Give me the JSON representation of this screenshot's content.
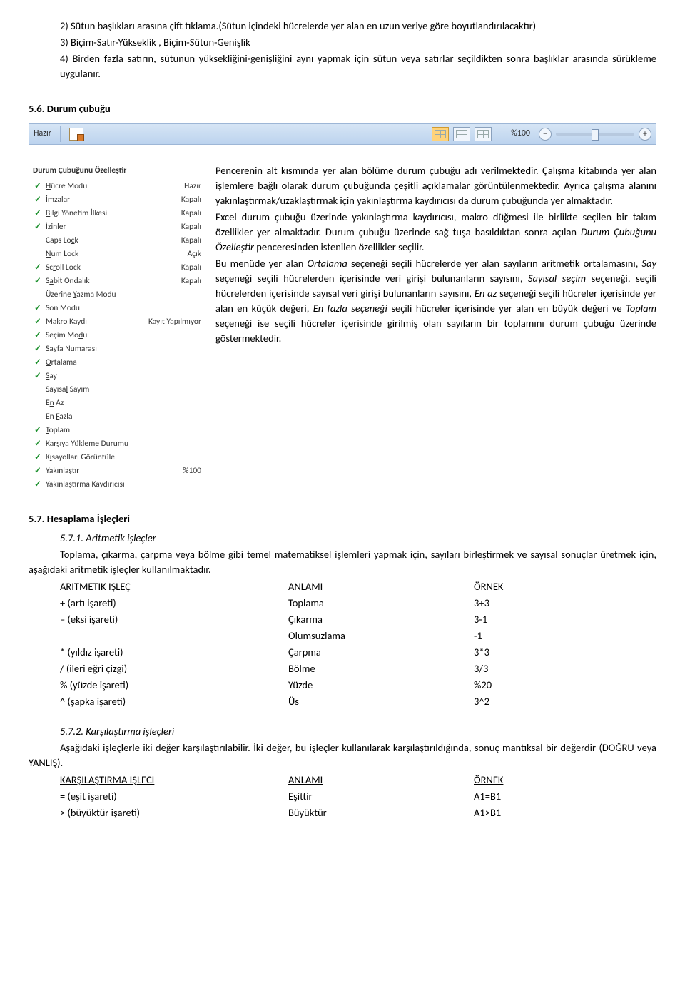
{
  "top": {
    "l1": "2) Sütun başlıkları arasına çift tıklama.(Sütun içindeki hücrelerde yer alan en uzun veriye göre boyutlandırılacaktır)",
    "l2": "3) Biçim-Satır-Yükseklik , Biçim-Sütun-Genişlik",
    "l3": "4) Birden fazla satırın, sütunun yüksekliğini-genişliğini aynı yapmak için sütun veya satırlar seçildikten sonra başlıklar arasında sürükleme uygulanır."
  },
  "s56": {
    "title": "5.6. Durum çubuğu"
  },
  "statusbar": {
    "ready": "Hazır",
    "zoom": "%100"
  },
  "customize": {
    "title": "Durum Çubuğunu Özelleştir",
    "rows": [
      {
        "chk": true,
        "label": "<u>H</u>ücre Modu",
        "value": "Hazır"
      },
      {
        "chk": true,
        "label": "<u>İ</u>mzalar",
        "value": "Kapalı"
      },
      {
        "chk": true,
        "label": "<u>B</u>ilgi Yönetim İlkesi",
        "value": "Kapalı"
      },
      {
        "chk": true,
        "label": "<u>İ</u>zinler",
        "value": "Kapalı"
      },
      {
        "chk": false,
        "label": "Caps Lo<u>c</u>k",
        "value": "Kapalı"
      },
      {
        "chk": false,
        "label": "<u>N</u>um Lock",
        "value": "Açık"
      },
      {
        "chk": true,
        "label": "Sc<u>r</u>oll Lock",
        "value": "Kapalı"
      },
      {
        "chk": true,
        "label": "S<u>a</u>bit Ondalık",
        "value": "Kapalı"
      },
      {
        "chk": false,
        "label": "Üzerine <u>Y</u>azma Modu",
        "value": ""
      },
      {
        "chk": true,
        "label": "Son Modu",
        "value": ""
      },
      {
        "chk": true,
        "label": "<u>M</u>akro Kaydı",
        "value": "Kayıt Yapılmıyor"
      },
      {
        "chk": true,
        "label": "Seçim Mo<u>d</u>u",
        "value": ""
      },
      {
        "chk": true,
        "label": "Say<u>f</u>a Numarası",
        "value": ""
      },
      {
        "chk": true,
        "label": "<u>O</u>rtalama",
        "value": ""
      },
      {
        "chk": true,
        "label": "<u>S</u>ay",
        "value": ""
      },
      {
        "chk": false,
        "label": "Sayısa<u>l</u> Sayım",
        "value": ""
      },
      {
        "chk": false,
        "label": "E<u>n</u> Az",
        "value": ""
      },
      {
        "chk": false,
        "label": "En <u>F</u>azla",
        "value": ""
      },
      {
        "chk": true,
        "label": "<u>T</u>oplam",
        "value": ""
      },
      {
        "chk": true,
        "label": "<u>K</u>arşıya Yükleme Durumu",
        "value": ""
      },
      {
        "chk": true,
        "label": "K<u>ı</u>sayolları Görüntüle",
        "value": ""
      },
      {
        "chk": true,
        "label": "<u>Y</u>akınlaştır",
        "value": "%100"
      },
      {
        "chk": true,
        "label": "Yakınlaştırma Kaydırıcısı",
        "value": ""
      }
    ]
  },
  "right": {
    "p1a": "Pencerenin alt kısmında yer alan bölüme durum çubuğu adı verilmektedir. Çalışma kitabında yer alan işlemlere bağlı olarak durum çubuğunda çeşitli açıklamalar görüntülenmektedir. Ayrıca çalışma alanını yakınlaştırmak/uzaklaştırmak için yakınlaştırma kaydırıcısı da durum çubuğunda yer almaktadır.",
    "p1b": "Excel durum çubuğu üzerinde yakınlaştırma kaydırıcısı, makro düğmesi ile birlikte seçilen bir takım özellikler yer almaktadır. Durum çubuğu üzerinde sağ tuşa basıldıktan sonra açılan ",
    "p1b_i": "Durum Çubuğunu Özelleştir",
    "p1b2": " penceresinden istenilen özellikler seçilir.",
    "p2a": "Bu menüde yer alan ",
    "p2_ort": "Ortalama",
    "p2b": " seçeneği seçili hücrelerde yer alan sayıların aritmetik ortalamasını, ",
    "p2_say": "Say",
    "p2c": " seçeneği seçili hücrelerden içerisinde veri girişi bulunanların sayısını, ",
    "p2_ss": "Sayısal seçim",
    "p2d": " seçeneği, seçili hücrelerden içerisinde sayısal veri girişi bulunanların sayısını, ",
    "p2_enaz": "En az",
    "p2e": " seçeneği seçili hücreler içerisinde yer alan en küçük değeri, ",
    "p2_enfz": "En fazla seçeneği",
    "p2f": " seçili hücreler içerisinde yer alan en büyük değeri ve ",
    "p2_top": "Toplam",
    "p2g": " seçeneği ise seçili hücreler içerisinde girilmiş olan sayıların bir toplamını durum çubuğu üzerinde göstermektedir."
  },
  "s57": {
    "title": "5.7. Hesaplama İşleçleri",
    "s571": "5.7.1. Aritmetik işleçler",
    "p571": "Toplama, çıkarma, çarpma veya bölme gibi temel matematiksel işlemleri yapmak için, sayıları birleştirmek ve sayısal sonuçlar üretmek için, aşağıdaki aritmetik işleçler kullanılmaktadır.",
    "arith": {
      "h1": "ARITMETIK IŞLEÇ",
      "h2": "ANLAMI",
      "h3": "ÖRNEK",
      "rows": [
        [
          "+ (artı işareti)",
          "Toplama",
          "3+3"
        ],
        [
          "– (eksi işareti)",
          "Çıkarma",
          "3-1"
        ],
        [
          "",
          "Olumsuzlama",
          "-1"
        ],
        [
          "* (yıldız işareti)",
          "Çarpma",
          "3*3"
        ],
        [
          "/ (ileri eğri çizgi)",
          "Bölme",
          "3/3"
        ],
        [
          "% (yüzde işareti)",
          "Yüzde",
          "%20"
        ],
        [
          "^ (şapka işareti)",
          "Üs",
          "3^2"
        ]
      ]
    },
    "s572": "5.7.2. Karşılaştırma işleçleri",
    "p572": "Aşağıdaki işleçlerle iki değer karşılaştırılabilir. İki değer, bu işleçler kullanılarak karşılaştırıldığında, sonuç mantıksal bir değerdir (DOĞRU veya YANLIŞ).",
    "cmp": {
      "h1": "KARŞILAŞTIRMA IŞLECI",
      "h2": "ANLAMI",
      "h3": "ÖRNEK",
      "rows": [
        [
          "= (eşit işareti)",
          "Eşittir",
          "A1=B1"
        ],
        [
          "> (büyüktür işareti)",
          "Büyüktür",
          "A1>B1"
        ]
      ]
    }
  }
}
